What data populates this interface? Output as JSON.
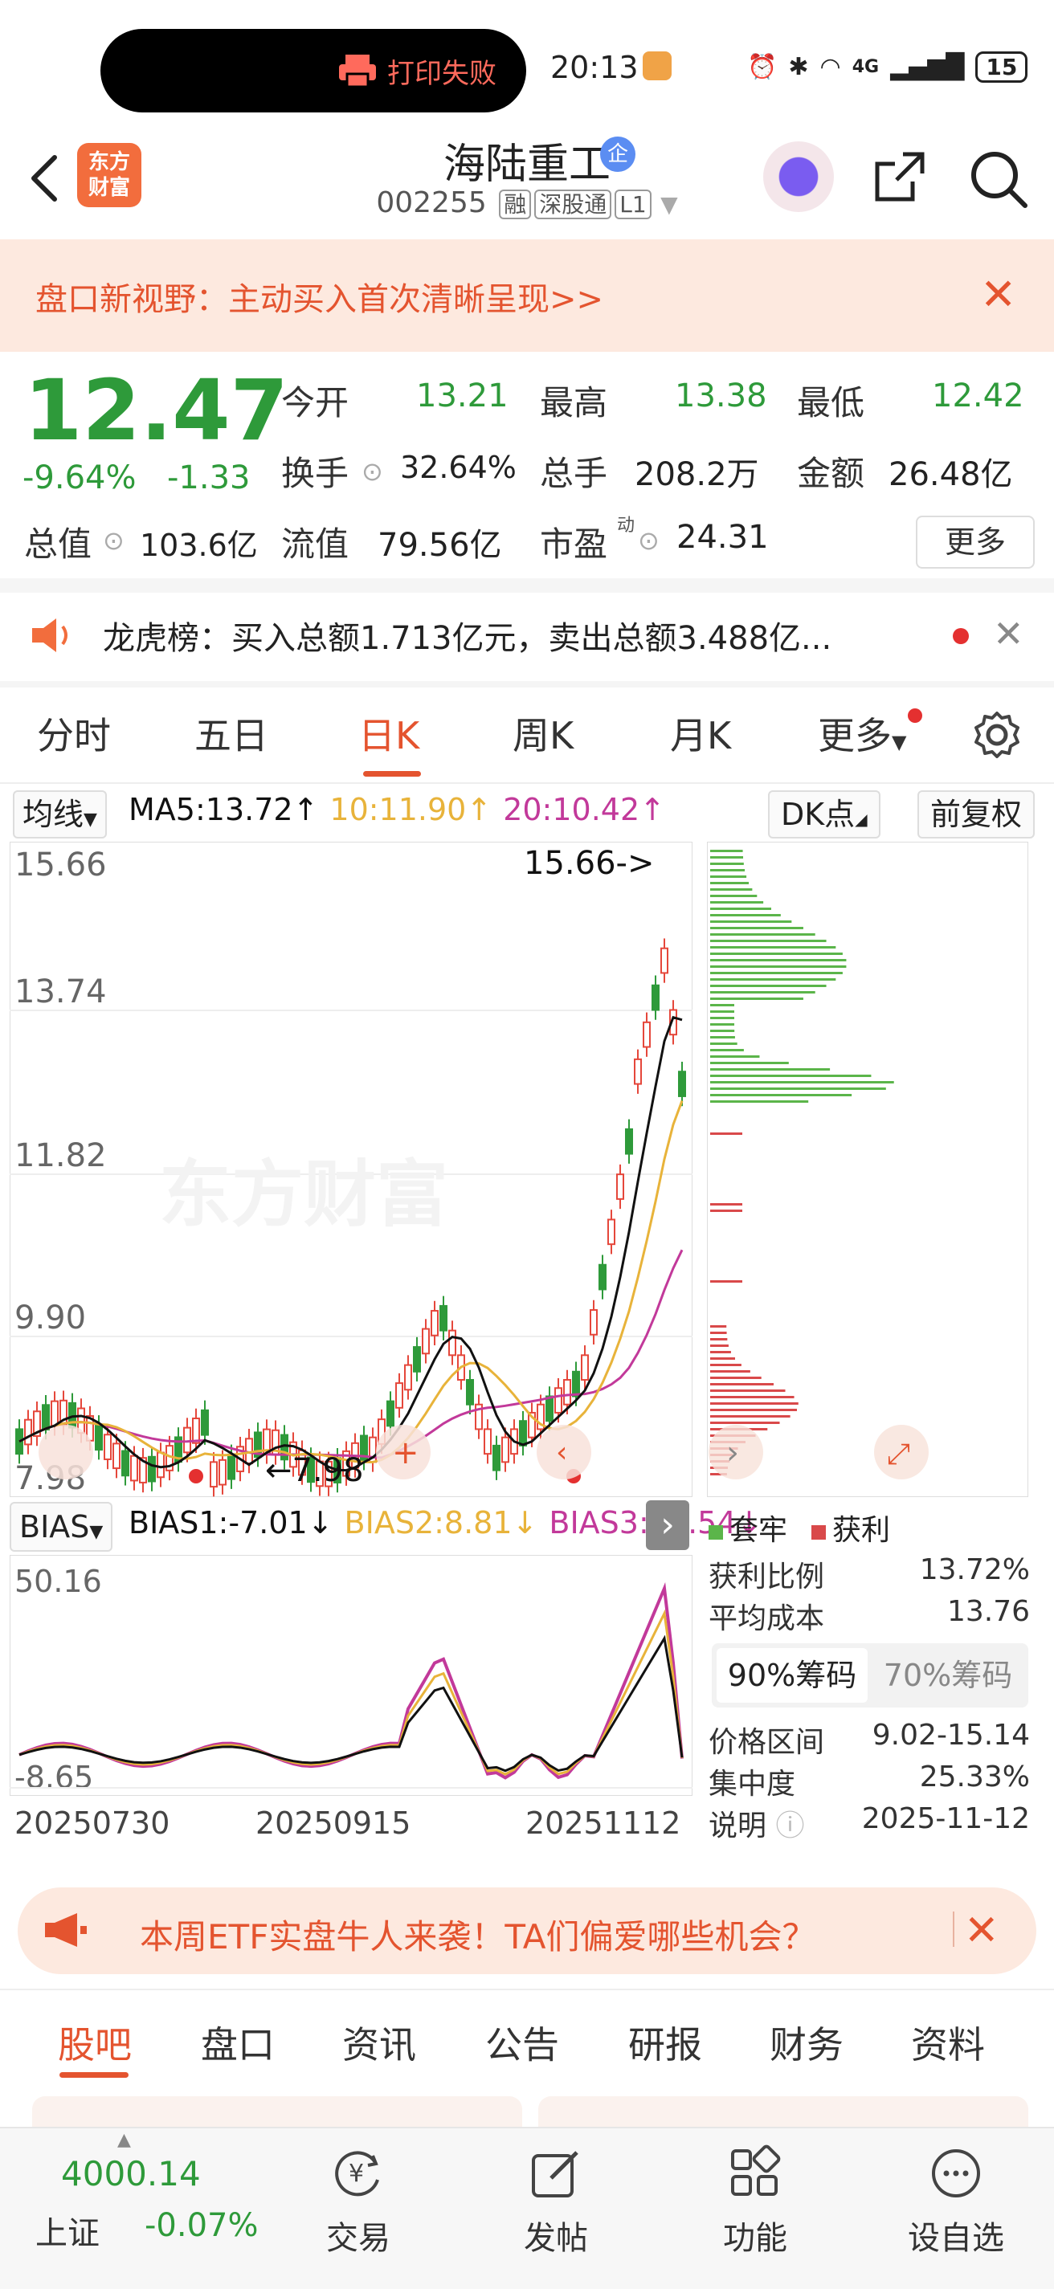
{
  "status_bar": {
    "notification": "打印失败",
    "time": "20:13",
    "network": "4G",
    "battery": "15"
  },
  "header": {
    "logo_text": "东方\n财富",
    "stock_name": "海陆重工",
    "stock_badge": "企",
    "stock_code": "002255",
    "tags": [
      "融",
      "深股通",
      "L1"
    ]
  },
  "banner": {
    "text": "盘口新视野：主动买入首次清晰呈现>>"
  },
  "quote": {
    "price": "12.47",
    "change_pct": "-9.64%",
    "change": "-1.33",
    "open_label": "今开",
    "open": "13.21",
    "high_label": "最高",
    "high": "13.38",
    "low_label": "最低",
    "low": "12.42",
    "turnover_label": "换手",
    "turnover": "32.64%",
    "volume_label": "总手",
    "volume": "208.2万",
    "amount_label": "金额",
    "amount": "26.48亿",
    "mktcap_label": "总值",
    "mktcap": "103.6亿",
    "float_label": "流值",
    "float": "79.56亿",
    "pe_label": "市盈",
    "pe_sup": "动",
    "pe": "24.31",
    "more": "更多"
  },
  "notice": {
    "text": "龙虎榜：买入总额1.713亿元，卖出总额3.488亿..."
  },
  "tabs": [
    "分时",
    "五日",
    "日K",
    "周K",
    "月K",
    "更多"
  ],
  "ma_row": {
    "select": "均线",
    "ma5": "MA5:13.72↑",
    "ma10": "10:11.90↑",
    "ma20": "20:10.42↑",
    "dk": "DK点",
    "adjust": "前复权"
  },
  "chart_data": {
    "type": "candlestick",
    "y_labels": [
      "15.66",
      "13.74",
      "11.82",
      "9.90",
      "7.98"
    ],
    "ylim": [
      7.98,
      15.66
    ],
    "max_annotation": "15.66->",
    "min_annotation": "7.98",
    "watermark": "东方财富",
    "dates": [
      "20250730",
      "20250915",
      "20251112"
    ]
  },
  "bias": {
    "select": "BIAS",
    "bias1": "BIAS1:-7.01↓",
    "bias2": "BIAS2:8.81↓",
    "bias3": "BIAS3:21.54↓",
    "y_top": "50.16",
    "y_bottom": "-8.65"
  },
  "chip": {
    "legend_trapped": "套牢",
    "legend_profit": "获利",
    "rows": [
      {
        "label": "获利比例",
        "value": "13.72%"
      },
      {
        "label": "平均成本",
        "value": "13.76"
      }
    ],
    "tab_90": "90%筹码",
    "tab_70": "70%筹码",
    "rows2": [
      {
        "label": "价格区间",
        "value": "9.02-15.14"
      },
      {
        "label": "集中度",
        "value": "25.33%"
      },
      {
        "label": "说明",
        "value": "2025-11-12"
      }
    ]
  },
  "etf": {
    "text": "本周ETF实盘牛人来袭！TA们偏爱哪些机会？"
  },
  "bottom_tabs": [
    "股吧",
    "盘口",
    "资讯",
    "公告",
    "研报",
    "财务",
    "资料"
  ],
  "index": {
    "value": "4000.14",
    "name": "上证",
    "pct": "-0.07%"
  },
  "nav": [
    "交易",
    "发帖",
    "功能",
    "设自选"
  ],
  "colors": {
    "up": "#e5473b",
    "down": "#2e9a3a",
    "accent": "#e4542f",
    "ma5": "#111111",
    "ma10": "#e8b33a",
    "ma20": "#c2399a"
  }
}
